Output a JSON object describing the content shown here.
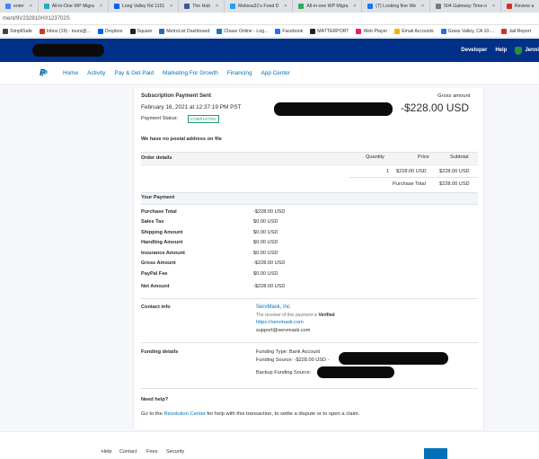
{
  "browser": {
    "tabs": [
      {
        "label": "enter",
        "color": "#4285f4"
      },
      {
        "label": "All-in-One WP Migra",
        "color": "#28a7c7"
      },
      {
        "label": "Long Valley Rd 1151",
        "color": "#0061ff"
      },
      {
        "label": "The Hub",
        "color": "#3b5998"
      },
      {
        "label": "Melissa31's Food D",
        "color": "#1da1f2"
      },
      {
        "label": "All-in-one WP Migra",
        "color": "#34a853"
      },
      {
        "label": "(7) Looking fine We",
        "color": "#1877f2"
      },
      {
        "label": "504 Gateway Time-o",
        "color": "#777777"
      },
      {
        "label": "Review a",
        "color": "#d93025"
      }
    ],
    "address": "ment/9V232810HX123702S",
    "bookmarks": [
      {
        "label": "SimpliSafe",
        "color": "#444444"
      },
      {
        "label": "Inbox (19) - tours@...",
        "color": "#d93025"
      },
      {
        "label": "Dropbox",
        "color": "#0061ff"
      },
      {
        "label": "Square",
        "color": "#222222"
      },
      {
        "label": "MetroList Dashboard",
        "color": "#1f6fb2"
      },
      {
        "label": "Chase Online - Log...",
        "color": "#117aca"
      },
      {
        "label": "Facebook",
        "color": "#1877f2"
      },
      {
        "label": "MATTERPORT",
        "color": "#222222"
      },
      {
        "label": "Web Player",
        "color": "#e91e63"
      },
      {
        "label": "Email Accounts",
        "color": "#f4b400"
      },
      {
        "label": "Grass Valley, CA 10-...",
        "color": "#1a73e8"
      },
      {
        "label": "Jail Report",
        "color": "#d32f2f"
      }
    ]
  },
  "header": {
    "developer": "Developer",
    "help": "Help",
    "user": "Jenni"
  },
  "nav": {
    "logo_icon": "paypal-logo",
    "items": [
      "Home",
      "Activity",
      "Pay & Get Paid",
      "Marketing For Growth",
      "Financing",
      "App Center"
    ]
  },
  "transaction": {
    "title": "Subscription Payment Sent",
    "date": "February 16, 2021 at 12:37:19 PM PST",
    "status_label": "Payment Status:",
    "status": "COMPLETED",
    "gross_label": "Gross amount",
    "gross_amount": "-$228.00 USD",
    "postal_note": "We have no postal address on file",
    "order": {
      "header": "Order details",
      "col_quantity": "Quantity",
      "col_price": "Price",
      "col_subtotal": "Subtotal",
      "quantity": "1",
      "price": "$228.00 USD",
      "subtotal": "$228.00 USD",
      "purchase_total_label": "Purchase Total",
      "purchase_total": "$228.00 USD"
    },
    "payment": {
      "header": "Your Payment",
      "rows": [
        {
          "label": "Purchase Total",
          "value": "-$228.00 USD"
        },
        {
          "label": "Sales Tax",
          "value": "$0.00 USD"
        },
        {
          "label": "Shipping Amount",
          "value": "$0.00 USD"
        },
        {
          "label": "Handling Amount",
          "value": "$0.00 USD"
        },
        {
          "label": "Insurance Amount",
          "value": "$0.00 USD"
        },
        {
          "label": "Gross Amount",
          "value": "-$228.00 USD"
        },
        {
          "label": "PayPal Fee",
          "value": "$0.00 USD"
        },
        {
          "label": "Net Amount",
          "value": "-$228.00 USD"
        }
      ]
    },
    "contact": {
      "label": "Contact info",
      "name": "ServMask, Inc",
      "verified_prefix": "The receiver of this payment is",
      "verified": "Verified",
      "website": "https://servmask.com",
      "email": "support@servmask.com"
    },
    "funding": {
      "label": "Funding details",
      "type": "Funding Type: Bank Account",
      "source": "Funding Source: -$228.00 USD -",
      "backup": "Backup Funding Source:"
    },
    "help": {
      "label": "Need help?",
      "prefix": "Go to the",
      "link": "Resolution Center",
      "suffix": "for help with this transaction, to settle a dispute or to open a claim."
    }
  },
  "footer": {
    "links": [
      "Help",
      "Contact",
      "Fees",
      "Security"
    ]
  }
}
